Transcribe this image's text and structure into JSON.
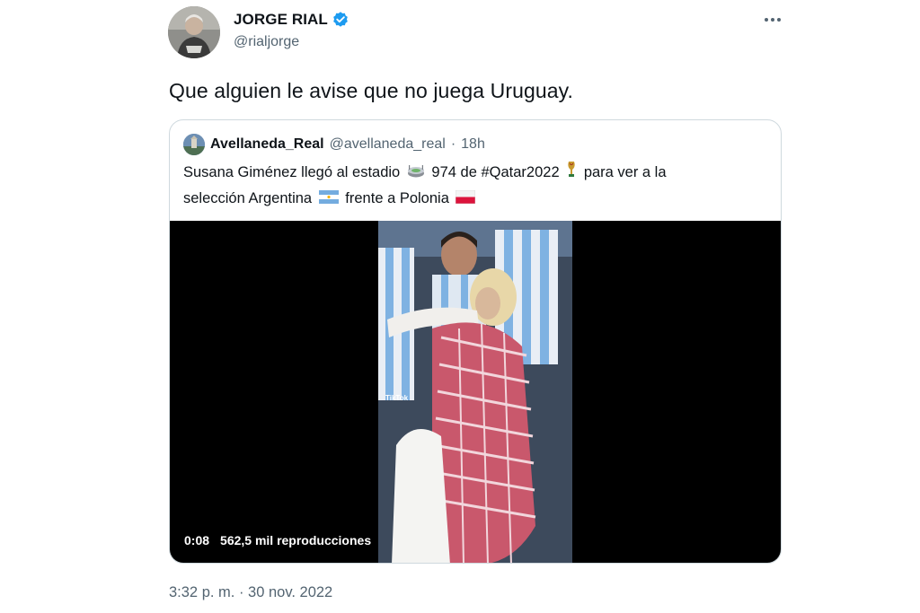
{
  "tweet": {
    "display_name": "JORGE RIAL",
    "handle": "@rialjorge",
    "text": "Que alguien le avise que no juega Uruguay.",
    "timestamp": "3:32 p. m. · 30 nov. 2022",
    "verified": true,
    "icons": {
      "verified": "verified-badge-icon",
      "more": "more-options-icon"
    }
  },
  "quote": {
    "display_name": "Avellaneda_Real",
    "handle": "@avellaneda_real",
    "separator": "·",
    "time": "18h",
    "text_part1": "Susana Giménez llegó al estadio",
    "text_part2": "974 de #Qatar2022",
    "text_part3": "para ver a la",
    "text_part4": "selección Argentina",
    "text_part5": "frente a Polonia",
    "emojis": [
      "stadium-emoji",
      "trophy-emoji",
      "argentina-flag-emoji",
      "poland-flag-emoji"
    ],
    "video": {
      "duration": "0:08",
      "views": "562,5 mil reproducciones",
      "watermark": "TikTok"
    }
  },
  "colors": {
    "verified": "#1d9bf0",
    "secondary_text": "#536471",
    "border": "#cfd9de"
  }
}
